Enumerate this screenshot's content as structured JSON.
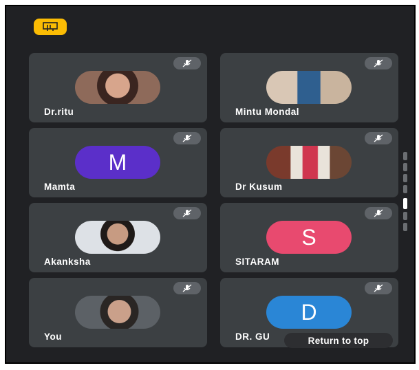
{
  "participants": [
    {
      "name": "Dr.ritu",
      "avatar_type": "photo",
      "muted": true
    },
    {
      "name": "Mintu Mondal",
      "avatar_type": "photo",
      "muted": true
    },
    {
      "name": "Mamta",
      "avatar_type": "letter",
      "letter": "M",
      "color": "#5b2fc9",
      "muted": true
    },
    {
      "name": "Dr Kusum",
      "avatar_type": "photo",
      "muted": true
    },
    {
      "name": "Akanksha",
      "avatar_type": "photo",
      "muted": true
    },
    {
      "name": "SITARAM",
      "avatar_type": "letter",
      "letter": "S",
      "color": "#e84a6f",
      "muted": true
    },
    {
      "name": "You",
      "avatar_type": "photo",
      "muted": true
    },
    {
      "name": "DR. GU",
      "avatar_type": "letter",
      "letter": "D",
      "color": "#2a86d6",
      "muted": true
    }
  ],
  "icons": {
    "top_badge": "presentation-icon",
    "mute": "mic-off-icon"
  },
  "return_to_top": "Return to top",
  "colors": {
    "background": "#202124",
    "tile": "#3c4043",
    "badge": "#fbbc04"
  }
}
